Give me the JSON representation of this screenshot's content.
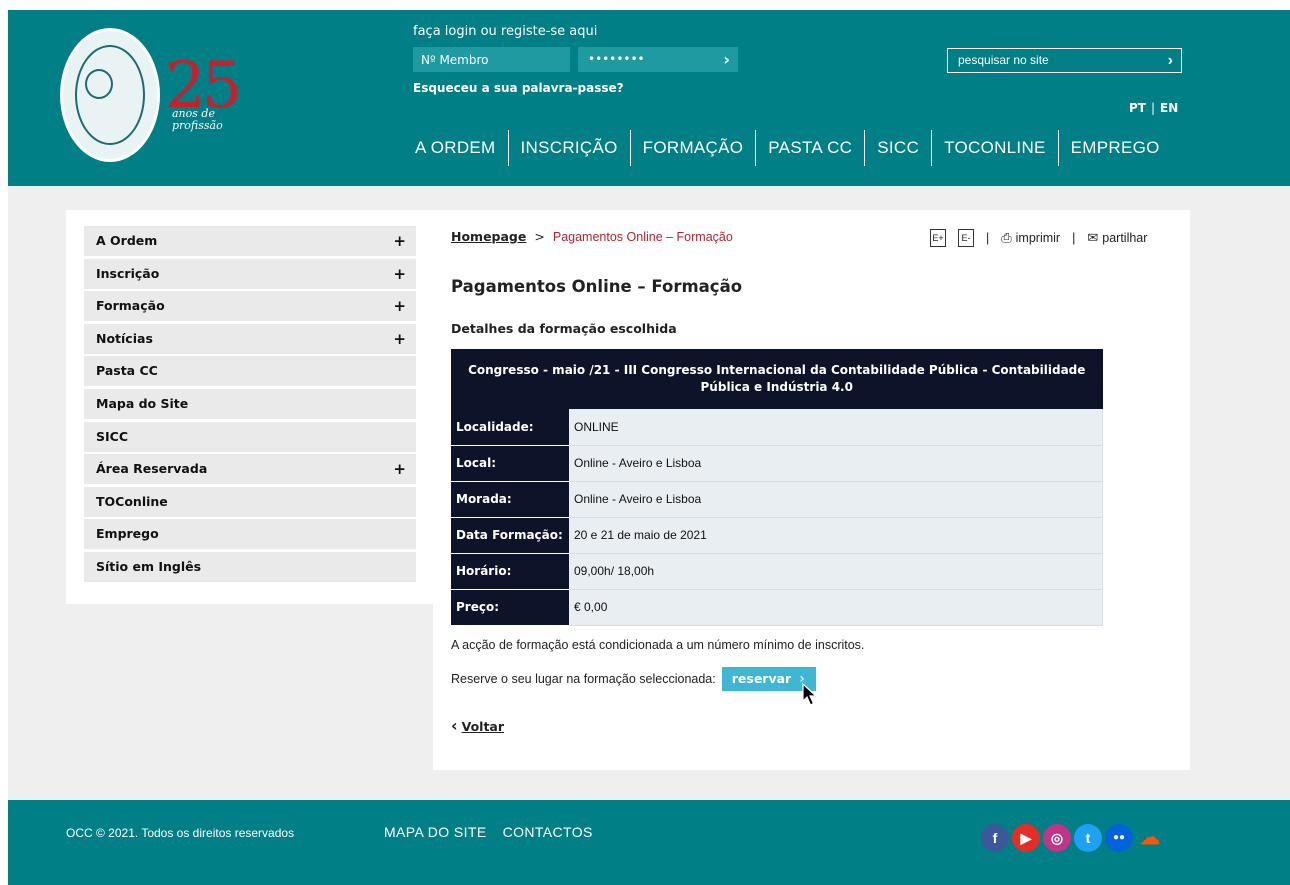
{
  "header": {
    "logo": {
      "anniversary_number": "25",
      "anniversary_text": "anos de profissão"
    },
    "login": {
      "prompt": "faça login ou registe-se aqui",
      "member_placeholder": "Nº Membro",
      "password_mask": "••••••••",
      "forgot_password": "Esqueceu a sua palavra-passe?"
    },
    "search": {
      "placeholder": "pesquisar no site"
    },
    "languages": [
      "PT",
      "EN"
    ],
    "nav": [
      "A ORDEM",
      "INSCRIÇÃO",
      "FORMAÇÃO",
      "PASTA CC",
      "SICC",
      "TOCONLINE",
      "EMPREGO"
    ]
  },
  "sidebar": {
    "items": [
      {
        "label": "A Ordem",
        "expandable": "+"
      },
      {
        "label": "Inscrição",
        "expandable": "+"
      },
      {
        "label": "Formação",
        "expandable": "+"
      },
      {
        "label": "Notícias",
        "expandable": "+"
      },
      {
        "label": "Pasta CC",
        "expandable": ""
      },
      {
        "label": "Mapa do Site",
        "expandable": ""
      },
      {
        "label": "SICC",
        "expandable": ""
      },
      {
        "label": "Área Reservada",
        "expandable": "+"
      },
      {
        "label": "TOConline",
        "expandable": ""
      },
      {
        "label": "Emprego",
        "expandable": ""
      },
      {
        "label": "Sítio em Inglês",
        "expandable": ""
      }
    ]
  },
  "breadcrumb": {
    "home": "Homepage",
    "separator": ">",
    "current": "Pagamentos Online – Formação"
  },
  "tools": {
    "increase_font": "E+",
    "decrease_font": "E-",
    "print": "imprimir",
    "share": "partilhar"
  },
  "main": {
    "title": "Pagamentos Online – Formação",
    "subtitle": "Detalhes da formação escolhida",
    "course_title": "Congresso - maio /21 - III Congresso Internacional da Contabilidade Pública - Contabilidade Pública e Indústria 4.0",
    "details": [
      {
        "label": "Localidade:",
        "value": "ONLINE"
      },
      {
        "label": "Local:",
        "value": "Online - Aveiro e Lisboa"
      },
      {
        "label": "Morada:",
        "value": "Online - Aveiro e Lisboa"
      },
      {
        "label": "Data Formação:",
        "value": "20 e 21 de maio de 2021"
      },
      {
        "label": "Horário:",
        "value": "09,00h/ 18,00h"
      },
      {
        "label": "Preço:",
        "value": "€ 0,00"
      }
    ],
    "note": "A acção de formação está condicionada a um número mínimo de inscritos.",
    "reserve_prompt": "Reserve o seu lugar na formação seleccionada:",
    "reserve_button": "reservar",
    "back_link": "Voltar"
  },
  "footer": {
    "copyright": "OCC © 2021. Todos os direitos reservados",
    "links": [
      "MAPA DO SITE",
      "CONTACTOS"
    ],
    "social": [
      {
        "name": "facebook-icon",
        "glyph": "f",
        "color": "#3b5998"
      },
      {
        "name": "youtube-icon",
        "glyph": "▶",
        "color": "#e52d27"
      },
      {
        "name": "instagram-icon",
        "glyph": "◎",
        "color": "#c13584"
      },
      {
        "name": "twitter-icon",
        "glyph": "t",
        "color": "#1da1f2"
      },
      {
        "name": "flickr-icon",
        "glyph": "●●",
        "color": "#0063dc"
      },
      {
        "name": "soundcloud-icon",
        "glyph": "☁",
        "color": "#ff5500"
      }
    ]
  },
  "colors": {
    "brand_teal": "#007f86",
    "table_dark": "#0d1429",
    "accent_red": "#b3262d",
    "button_cyan": "#3fb7d3"
  }
}
